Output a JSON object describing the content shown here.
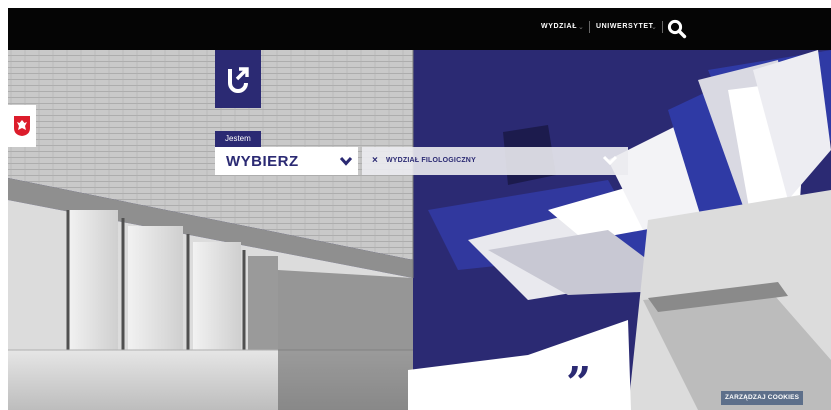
{
  "topnav": {
    "items": [
      {
        "label": "WYDZIAŁ"
      },
      {
        "label": "UNIWERSYTET"
      }
    ]
  },
  "icons": {
    "logo": "university-logo-icon",
    "flag": "polish-emblem-icon",
    "search": "search-icon",
    "chevron": "chevron-down-icon",
    "close": "close-icon",
    "quote": "quote-icon"
  },
  "selector": {
    "tag": "Jestem",
    "value": "WYBIERZ",
    "chip_label": "WYDZIAŁ FILOLOGICZNY",
    "chip_remove": "×"
  },
  "quote": {
    "mark": "”"
  },
  "cookies": {
    "label": "ZARZĄDZAJ COOKIES"
  },
  "colors": {
    "navy": "#2b2a73",
    "topbar": "#050505",
    "accent_blue": "#2f3aa5"
  }
}
